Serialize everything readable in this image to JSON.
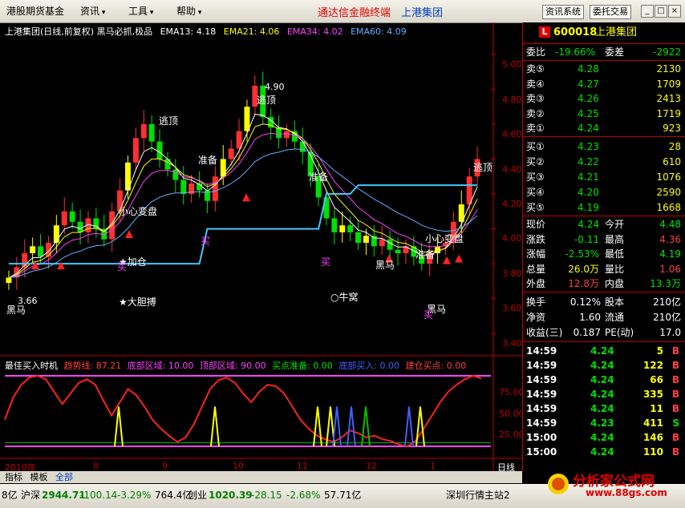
{
  "menu": {
    "items": [
      "港股期货基金",
      "资讯",
      "工具",
      "帮助"
    ],
    "banner_title": "通达信金融终端",
    "banner_group": "上港集团",
    "buttons": [
      "资讯系统",
      "委托交易"
    ],
    "window_buttons": [
      "_",
      "□",
      "×"
    ]
  },
  "chart": {
    "title": "上港集团(日线,前复权) 黑马必抓,极品",
    "ema": [
      {
        "label": "EMA13: 4.18",
        "color": "#ffffff"
      },
      {
        "label": "EMA21: 4.06",
        "color": "#ffff00"
      },
      {
        "label": "EMA34: 4.02",
        "color": "#ff40ff"
      },
      {
        "label": "EMA60: 4.09",
        "color": "#60b0ff"
      }
    ],
    "price_ticks": [
      "5.00",
      "4.80",
      "4.60",
      "4.40",
      "4.20",
      "4.00",
      "3.80",
      "3.60",
      "3.40"
    ],
    "annotations": {
      "high_value": "4.90",
      "low_value": "3.66",
      "taopding": "逃顶",
      "zhunbei": "准备",
      "mai": "买",
      "heima": "黑马",
      "xiaoxin": "小心变盘",
      "jiacang": "★加仓",
      "dadan": "★大胆搏",
      "niuwo": "○牛窝"
    },
    "indicator_title": "最佳买入时机",
    "indicator_items": [
      {
        "label": "趋势线: 87.21",
        "color": "#ff4040"
      },
      {
        "label": "底部区域: 10.00",
        "color": "#ff40ff"
      },
      {
        "label": "顶部区域: 90.00",
        "color": "#ff40ff"
      },
      {
        "label": "买点准备: 0.00",
        "color": "#00e000"
      },
      {
        "label": "底部买入: 0.00",
        "color": "#4060ff"
      },
      {
        "label": "建仓买点: 0.00",
        "color": "#ff4040"
      }
    ],
    "indicator_ticks": [
      "75.00",
      "50.00",
      "25.00"
    ],
    "x_ticks": [
      "2010年",
      "8",
      "9",
      "10",
      "11",
      "12",
      "1"
    ],
    "period": "日线"
  },
  "chart_data": {
    "type": "candlestick",
    "title": "上港集团(日线,前复权) 黑马必抓,极品",
    "ylim": [
      3.3,
      5.1
    ],
    "x": [
      "2010-07",
      "2010-08",
      "2010-09",
      "2010-10",
      "2010-11",
      "2010-12",
      "2011-01"
    ],
    "series": [
      {
        "name": "EMA13",
        "last": 4.18
      },
      {
        "name": "EMA21",
        "last": 4.06
      },
      {
        "name": "EMA34",
        "last": 4.02
      },
      {
        "name": "EMA60",
        "last": 4.09
      }
    ],
    "close_path": [
      3.72,
      3.78,
      3.86,
      3.9,
      3.84,
      3.92,
      4.02,
      4.1,
      4.04,
      3.98,
      4.06,
      4.0,
      3.94,
      4.1,
      4.22,
      4.38,
      4.52,
      4.6,
      4.5,
      4.4,
      4.34,
      4.28,
      4.2,
      4.26,
      4.22,
      4.16,
      4.3,
      4.4,
      4.46,
      4.56,
      4.7,
      4.82,
      4.64,
      4.58,
      4.52,
      4.56,
      4.5,
      4.44,
      4.3,
      4.18,
      4.06,
      3.98,
      4.02,
      3.98,
      3.92,
      3.96,
      3.9,
      3.94,
      3.88,
      3.86,
      3.9,
      3.84,
      3.8,
      3.86,
      3.9,
      3.92,
      4.04,
      4.14,
      4.3,
      4.4
    ],
    "high": 4.9,
    "low": 3.66,
    "indicator": {
      "name": "最佳买入时机",
      "ylim": [
        0,
        100
      ],
      "trend_last": 87.21,
      "bottom": 10.0,
      "top": 90.0,
      "ready": 0.0,
      "bottom_buy": 0.0,
      "build_buy": 0.0,
      "trend_path": [
        40,
        65,
        80,
        88,
        90,
        86,
        72,
        58,
        70,
        82,
        86,
        80,
        62,
        45,
        60,
        75,
        68,
        55,
        40,
        30,
        22,
        15,
        20,
        35,
        55,
        75,
        85,
        88,
        82,
        70,
        60,
        72,
        80,
        78,
        70,
        55,
        40,
        30,
        22,
        18,
        15,
        20,
        28,
        25,
        20,
        22,
        18,
        16,
        12,
        10,
        16,
        30,
        45,
        60,
        72,
        80,
        86,
        90,
        87
      ]
    }
  },
  "panel": {
    "code": "600018",
    "name": "上港集团",
    "weibi_label": "委比",
    "weibi": "-19.66%",
    "weicha_label": "委差",
    "weicha": "-2922",
    "sells": [
      {
        "label": "卖⑤",
        "price": "4.28",
        "vol": "2130"
      },
      {
        "label": "卖④",
        "price": "4.27",
        "vol": "1709"
      },
      {
        "label": "卖③",
        "price": "4.26",
        "vol": "2413"
      },
      {
        "label": "卖②",
        "price": "4.25",
        "vol": "1719"
      },
      {
        "label": "卖①",
        "price": "4.24",
        "vol": "923"
      }
    ],
    "buys": [
      {
        "label": "买①",
        "price": "4.23",
        "vol": "28"
      },
      {
        "label": "买②",
        "price": "4.22",
        "vol": "610"
      },
      {
        "label": "买③",
        "price": "4.21",
        "vol": "1076"
      },
      {
        "label": "买④",
        "price": "4.20",
        "vol": "2590"
      },
      {
        "label": "买⑤",
        "price": "4.19",
        "vol": "1668"
      }
    ],
    "stats": [
      {
        "l1": "现价",
        "v1": "4.24",
        "c1": "#00e000",
        "l2": "今开",
        "v2": "4.48",
        "c2": "#00e000"
      },
      {
        "l1": "涨跌",
        "v1": "-0.11",
        "c1": "#00e000",
        "l2": "最高",
        "v2": "4.36",
        "c2": "#ff4040"
      },
      {
        "l1": "涨幅",
        "v1": "-2.53%",
        "c1": "#00e000",
        "l2": "最低",
        "v2": "4.19",
        "c2": "#00e000"
      },
      {
        "l1": "总量",
        "v1": "26.0万",
        "c1": "#ffff00",
        "l2": "量比",
        "v2": "1.06",
        "c2": "#ff4040"
      },
      {
        "l1": "外盘",
        "v1": "12.8万",
        "c1": "#ff4040",
        "l2": "内盘",
        "v2": "13.3万",
        "c2": "#00e000"
      }
    ],
    "stats2": [
      {
        "l1": "换手",
        "v1": "0.12%",
        "l2": "股本",
        "v2": "210亿"
      },
      {
        "l1": "净资",
        "v1": "1.60",
        "l2": "流通",
        "v2": "210亿"
      },
      {
        "l1": "收益(三)",
        "v1": "0.187",
        "l2": "PE(动)",
        "v2": "17.0"
      }
    ],
    "ticks": [
      {
        "time": "14:59",
        "price": "4.24",
        "vol": "5",
        "dir": "B"
      },
      {
        "time": "14:59",
        "price": "4.24",
        "vol": "122",
        "dir": "B"
      },
      {
        "time": "14:59",
        "price": "4.24",
        "vol": "66",
        "dir": "B"
      },
      {
        "time": "14:59",
        "price": "4.24",
        "vol": "335",
        "dir": "B"
      },
      {
        "time": "14:59",
        "price": "4.24",
        "vol": "11",
        "dir": "B"
      },
      {
        "time": "14:59",
        "price": "4.23",
        "vol": "411",
        "dir": "S"
      },
      {
        "time": "15:00",
        "price": "4.24",
        "vol": "146",
        "dir": "B"
      },
      {
        "time": "15:00",
        "price": "4.24",
        "vol": "110",
        "dir": "B"
      }
    ]
  },
  "tabs": [
    "指标",
    "模板",
    "全部"
  ],
  "status": {
    "prefix": "8亿",
    "hs_label": "沪深",
    "hs_val": "2944.71",
    "hs_chg": "-100.14",
    "hs_pct": "-3.29%",
    "hs_amt": "764.4亿",
    "cy_label": "创业",
    "cy_val": "1020.39",
    "cy_chg": "-28.15",
    "cy_pct": "-2.68%",
    "cy_amt": "57.71亿",
    "station": "深圳行情主站2"
  },
  "logo": {
    "text": "分析家公式网",
    "url": "www.88gs.com"
  }
}
